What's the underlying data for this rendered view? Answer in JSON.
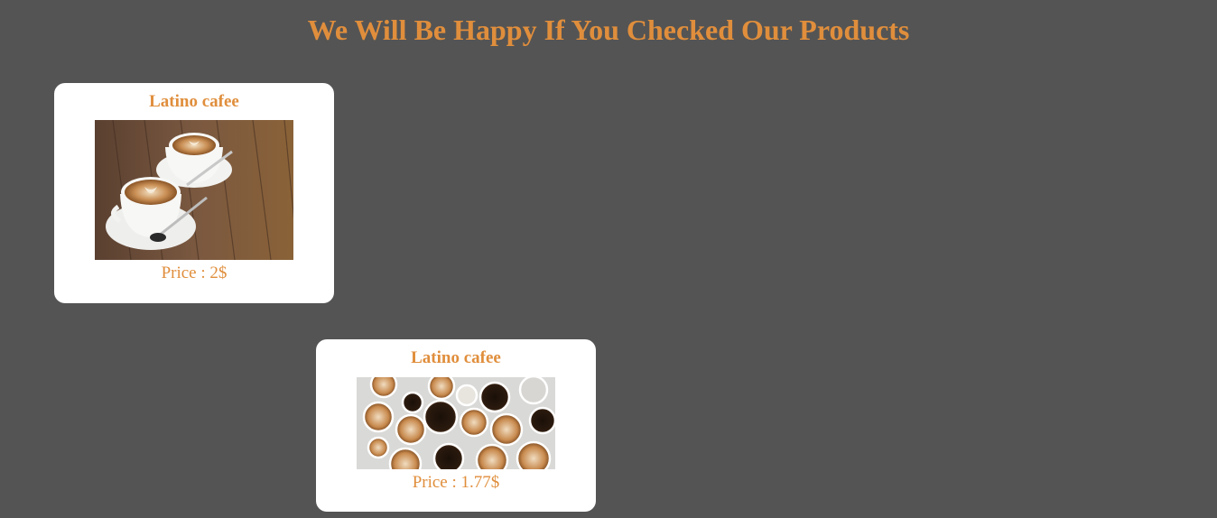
{
  "header": {
    "title": "We Will Be Happy If You Checked Our Products"
  },
  "colors": {
    "background": "#545454",
    "accent": "#e08e3c",
    "card": "#ffffff"
  },
  "products": [
    {
      "name": "Latino cafee",
      "image": "latte-art-cups-on-wooden-table",
      "price_text": "Price : 2$"
    },
    {
      "name": "Latino cafee",
      "image": "assorted-coffee-cups-top-view",
      "price_text": "Price : 1.77$"
    }
  ]
}
